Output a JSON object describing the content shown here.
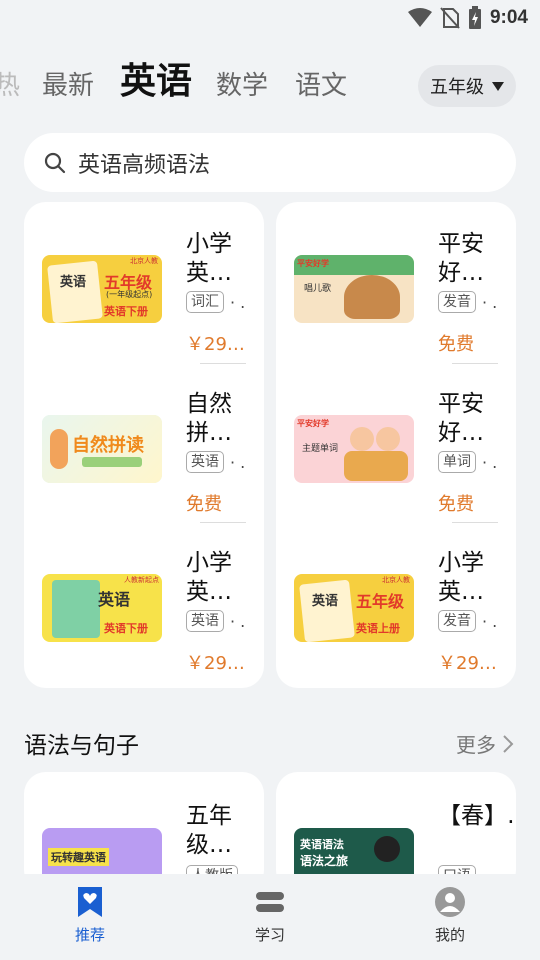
{
  "status": {
    "time": "9:04"
  },
  "tabs": {
    "partial": "热",
    "t1": "最新",
    "active": "英语",
    "t3": "数学",
    "t4": "语文"
  },
  "grade": {
    "label": "五年级"
  },
  "search": {
    "text": "英语高频语法"
  },
  "grid": [
    {
      "title": "小学英…",
      "tag": "词汇",
      "price": "￥29…"
    },
    {
      "title": "平安好…",
      "tag": "发音",
      "price": "免费"
    },
    {
      "title": "自然拼…",
      "tag": "英语",
      "price": "免费"
    },
    {
      "title": "平安好…",
      "tag": "单词",
      "price": "免费"
    },
    {
      "title": "小学英…",
      "tag": "英语",
      "price": "￥29…"
    },
    {
      "title": "小学英…",
      "tag": "发音",
      "price": "￥29…"
    }
  ],
  "thumbs": {
    "a_title": "英语",
    "a_badge": "五年级",
    "a_sub": "(一年级起点)",
    "a_foot": "英语下册",
    "a_pub": "北京人教",
    "b_brand": "平安好学",
    "b_text": "唱儿歌",
    "c_title": "自然拼读",
    "d_brand": "平安好学",
    "d_text": "主题单词",
    "e_title": "英语",
    "e_foot": "英语下册",
    "e_pub": "人教新起点",
    "f_title": "英语",
    "f_badge": "五年级",
    "f_foot": "英语上册",
    "f_pub": "北京人教"
  },
  "section": {
    "title": "语法与句子",
    "more": "更多"
  },
  "bottom_cards": [
    {
      "title": "五年级…",
      "tag": "人教版"
    },
    {
      "title": "【春】…",
      "tag": "口语"
    }
  ],
  "bottom_thumbs": {
    "g_text": "玩转趣英语",
    "h_line1": "英语语法",
    "h_line2": "语法之旅"
  },
  "nav": {
    "recommend": "推荐",
    "study": "学习",
    "mine": "我的"
  },
  "colors": {
    "accent": "#1a5fd1",
    "price": "#e07a2c"
  }
}
